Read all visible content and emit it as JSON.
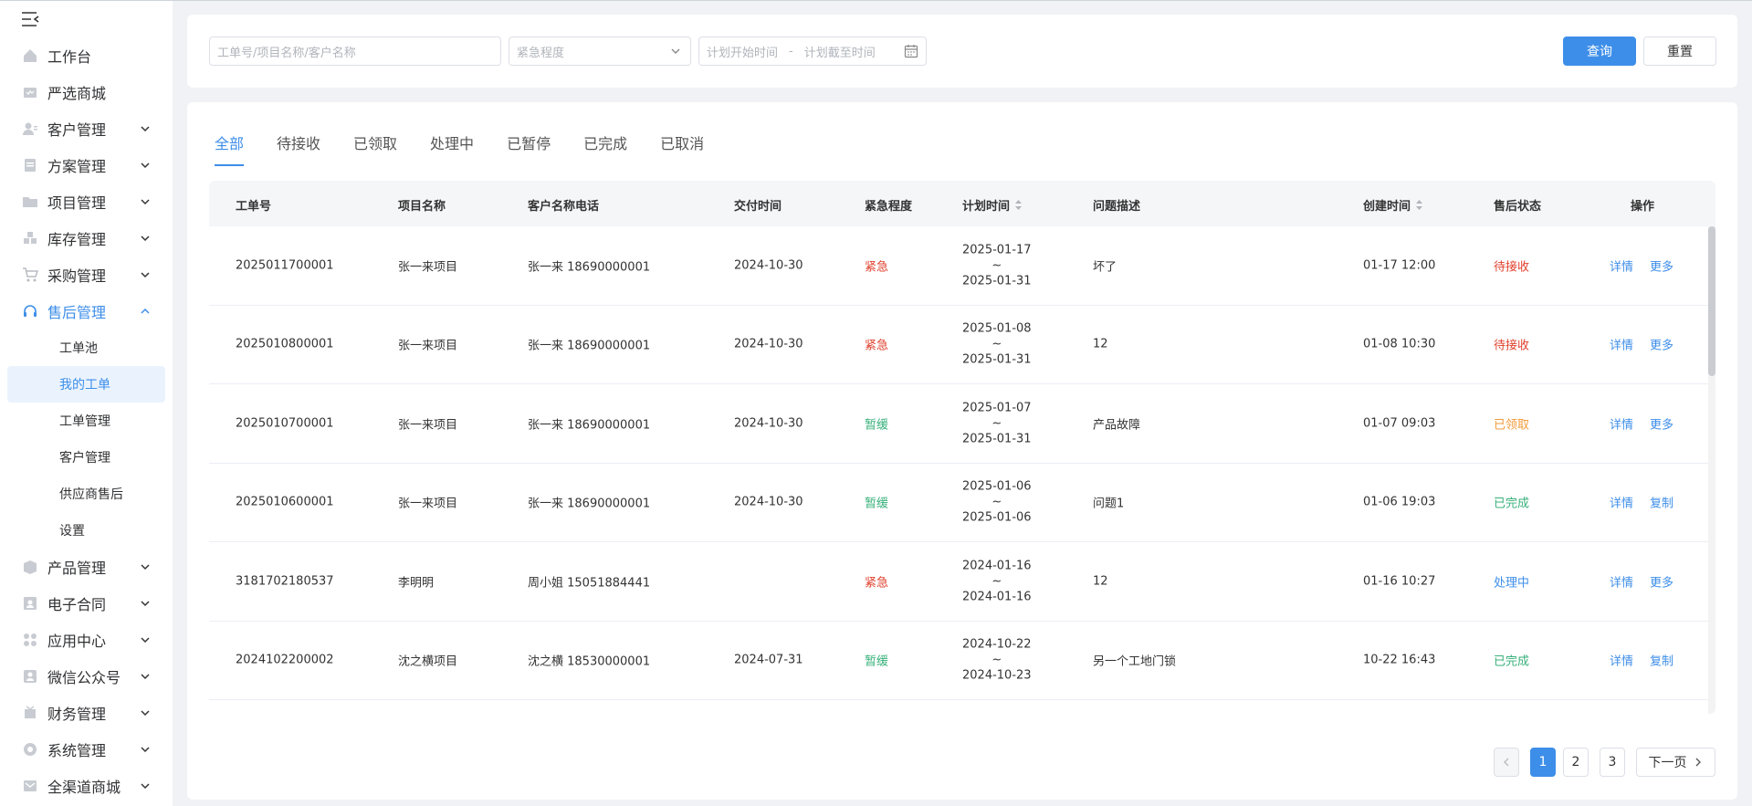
{
  "sidebar": {
    "menu": [
      {
        "label": "工作台",
        "icon": "home-icon"
      },
      {
        "label": "严选商城",
        "icon": "mall-icon"
      },
      {
        "label": "客户管理",
        "icon": "customer-icon"
      },
      {
        "label": "方案管理",
        "icon": "plan-icon"
      },
      {
        "label": "项目管理",
        "icon": "folder-icon"
      },
      {
        "label": "库存管理",
        "icon": "inventory-icon"
      },
      {
        "label": "采购管理",
        "icon": "cart-icon"
      },
      {
        "label": "售后管理",
        "icon": "headset-icon"
      },
      {
        "label": "产品管理",
        "icon": "box-icon"
      },
      {
        "label": "电子合同",
        "icon": "contract-icon"
      },
      {
        "label": "应用中心",
        "icon": "apps-icon"
      },
      {
        "label": "微信公众号",
        "icon": "wechat-icon"
      },
      {
        "label": "财务管理",
        "icon": "finance-icon"
      },
      {
        "label": "系统管理",
        "icon": "settings-icon"
      },
      {
        "label": "全渠道商城",
        "icon": "channel-icon"
      }
    ],
    "submenu": [
      "工单池",
      "我的工单",
      "工单管理",
      "客户管理",
      "供应商售后",
      "设置"
    ]
  },
  "filter": {
    "keyword_placeholder": "工单号/项目名称/客户名称",
    "urgency_placeholder": "紧急程度",
    "start_placeholder": "计划开始时间",
    "separator": "-",
    "end_placeholder": "计划截至时间",
    "query_label": "查询",
    "reset_label": "重置"
  },
  "tabs": [
    "全部",
    "待接收",
    "已领取",
    "处理中",
    "已暂停",
    "已完成",
    "已取消"
  ],
  "table": {
    "headers": {
      "order_no": "工单号",
      "project": "项目名称",
      "customer": "客户名称电话",
      "delivery": "交付时间",
      "urgency": "紧急程度",
      "plan": "计划时间",
      "problem": "问题描述",
      "created": "创建时间",
      "status": "售后状态",
      "action": "操作"
    },
    "rows": [
      {
        "order_no": "2025011700001",
        "project": "张一来项目",
        "customer": "张一来  18690000001",
        "delivery": "2024-10-30",
        "urgency": "紧急",
        "plan_start": "2025-01-17",
        "plan_sep": "~",
        "plan_end": "2025-01-31",
        "problem": "坏了",
        "created": "01-17 12:00",
        "status": "待接收",
        "action1": "详情",
        "action2": "更多"
      },
      {
        "order_no": "2025010800001",
        "project": "张一来项目",
        "customer": "张一来  18690000001",
        "delivery": "2024-10-30",
        "urgency": "紧急",
        "plan_start": "2025-01-08",
        "plan_sep": "~",
        "plan_end": "2025-01-31",
        "problem": "12",
        "created": "01-08 10:30",
        "status": "待接收",
        "action1": "详情",
        "action2": "更多"
      },
      {
        "order_no": "2025010700001",
        "project": "张一来项目",
        "customer": "张一来  18690000001",
        "delivery": "2024-10-30",
        "urgency": "暂缓",
        "plan_start": "2025-01-07",
        "plan_sep": "~",
        "plan_end": "2025-01-31",
        "problem": "产品故障",
        "created": "01-07 09:03",
        "status": "已领取",
        "action1": "详情",
        "action2": "更多"
      },
      {
        "order_no": "2025010600001",
        "project": "张一来项目",
        "customer": "张一来  18690000001",
        "delivery": "2024-10-30",
        "urgency": "暂缓",
        "plan_start": "2025-01-06",
        "plan_sep": "~",
        "plan_end": "2025-01-06",
        "problem": "问题1",
        "created": "01-06 19:03",
        "status": "已完成",
        "action1": "详情",
        "action2": "复制"
      },
      {
        "order_no": "3181702180537",
        "project": "李明明",
        "customer": "周小姐  15051884441",
        "delivery": "",
        "urgency": "紧急",
        "plan_start": "2024-01-16",
        "plan_sep": "~",
        "plan_end": "2024-01-16",
        "problem": "12",
        "created": "01-16 10:27",
        "status": "处理中",
        "action1": "详情",
        "action2": "更多"
      },
      {
        "order_no": "2024102200002",
        "project": "沈之横项目",
        "customer": "沈之横  18530000001",
        "delivery": "2024-07-31",
        "urgency": "暂缓",
        "plan_start": "2024-10-22",
        "plan_sep": "~",
        "plan_end": "2024-10-23",
        "problem": "另一个工地门锁",
        "created": "10-22 16:43",
        "status": "已完成",
        "action1": "详情",
        "action2": "复制"
      }
    ]
  },
  "pagination": {
    "pages": [
      "1",
      "2",
      "3"
    ],
    "next_label": "下一页"
  },
  "colors": {
    "accent": "#3d8ee9",
    "urgent": "#e0412d",
    "deferred": "#37b07a",
    "pending": "#e0412d",
    "received": "#f29a3a",
    "done": "#37b07a",
    "processing": "#3d8ee9"
  }
}
